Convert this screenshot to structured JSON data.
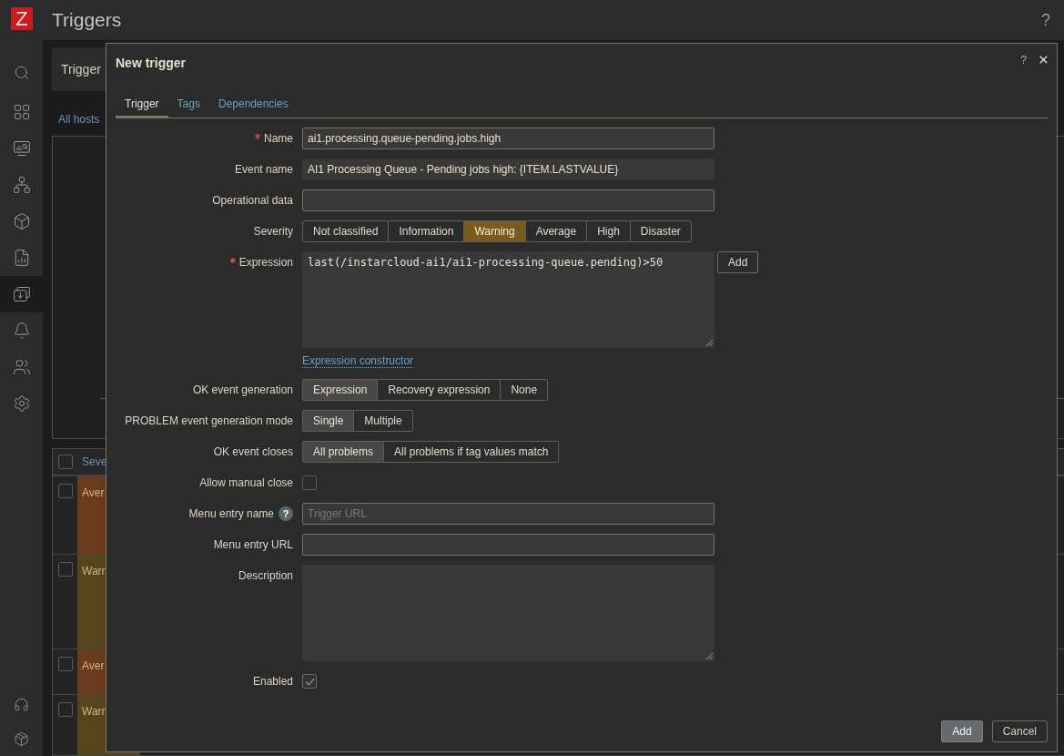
{
  "sidebar": {
    "logo": "Z",
    "items": [
      {
        "kind": "search",
        "selected": false
      },
      {
        "kind": "dashboards",
        "selected": false
      },
      {
        "kind": "monitoring",
        "selected": false
      },
      {
        "kind": "services",
        "selected": false
      },
      {
        "kind": "inventory",
        "selected": false
      },
      {
        "kind": "reports",
        "selected": false
      },
      {
        "kind": "collection",
        "selected": true
      },
      {
        "kind": "alerts",
        "selected": false
      },
      {
        "kind": "users",
        "selected": false
      },
      {
        "kind": "administration",
        "selected": false
      }
    ],
    "bottom_items": [
      {
        "kind": "support",
        "selected": false
      },
      {
        "kind": "integrations",
        "selected": false
      }
    ]
  },
  "header": {
    "title": "Triggers",
    "help": "?"
  },
  "filter": {
    "tab": "Trigger",
    "host_link": "All hosts"
  },
  "table": {
    "select_all_checked": false,
    "columns": [
      "Seve"
    ],
    "rows": [
      {
        "checked": false,
        "severity": "Aver",
        "color": "#693a1e"
      },
      {
        "checked": false,
        "severity": "Warn",
        "color": "#56441a"
      },
      {
        "checked": false,
        "severity": "Aver",
        "color": "#693a1e"
      },
      {
        "checked": false,
        "severity": "Warn",
        "color": "#56441a"
      }
    ]
  },
  "dialog": {
    "title": "New trigger",
    "help": "?",
    "tabs": [
      {
        "label": "Trigger",
        "selected": true
      },
      {
        "label": "Tags",
        "selected": false
      },
      {
        "label": "Dependencies",
        "selected": false
      }
    ],
    "fields": [
      {
        "kind": "input",
        "label": "Name",
        "required": true,
        "value": "ai1.processing.queue-pending.jobs.high"
      },
      {
        "kind": "readonly",
        "label": "Event name",
        "required": false,
        "value": "AI1 Processing Queue - Pending jobs high: {ITEM.LASTVALUE}"
      },
      {
        "kind": "input",
        "label": "Operational data",
        "required": false
      },
      {
        "kind": "severity",
        "label": "Severity",
        "required": false,
        "options": [
          {
            "label": "Not classified",
            "selected": false
          },
          {
            "label": "Information",
            "selected": false
          },
          {
            "label": "Warning",
            "selected": true
          },
          {
            "label": "Average",
            "selected": false
          },
          {
            "label": "High",
            "selected": false
          },
          {
            "label": "Disaster",
            "selected": false
          }
        ]
      },
      {
        "kind": "expression",
        "label": "Expression",
        "required": true,
        "value": "last(/instarcloud-ai1/ai1-processing-queue.pending)>50",
        "button": "Add",
        "link": "Expression constructor"
      },
      {
        "kind": "segmented",
        "label": "OK event generation",
        "required": false,
        "options": [
          {
            "label": "Expression",
            "selected": true
          },
          {
            "label": "Recovery expression",
            "selected": false
          },
          {
            "label": "None",
            "selected": false
          }
        ]
      },
      {
        "kind": "segmented",
        "label": "PROBLEM event generation mode",
        "required": false,
        "options": [
          {
            "label": "Single",
            "selected": true
          },
          {
            "label": "Multiple",
            "selected": false
          }
        ]
      },
      {
        "kind": "segmented",
        "label": "OK event closes",
        "required": false,
        "options": [
          {
            "label": "All problems",
            "selected": true
          },
          {
            "label": "All problems if tag values match",
            "selected": false
          }
        ]
      },
      {
        "kind": "checkbox",
        "label": "Allow manual close",
        "required": false,
        "checked": false
      },
      {
        "kind": "input",
        "label": "Menu entry name",
        "required": false,
        "hint": "?",
        "placeholder": "Trigger URL"
      },
      {
        "kind": "input",
        "label": "Menu entry URL",
        "required": false
      },
      {
        "kind": "textarea",
        "label": "Description",
        "required": false
      },
      {
        "kind": "checkbox",
        "label": "Enabled",
        "required": false,
        "checked": true
      }
    ],
    "buttons": [
      {
        "label": "Add",
        "primary": true
      },
      {
        "label": "Cancel",
        "primary": false
      }
    ]
  }
}
